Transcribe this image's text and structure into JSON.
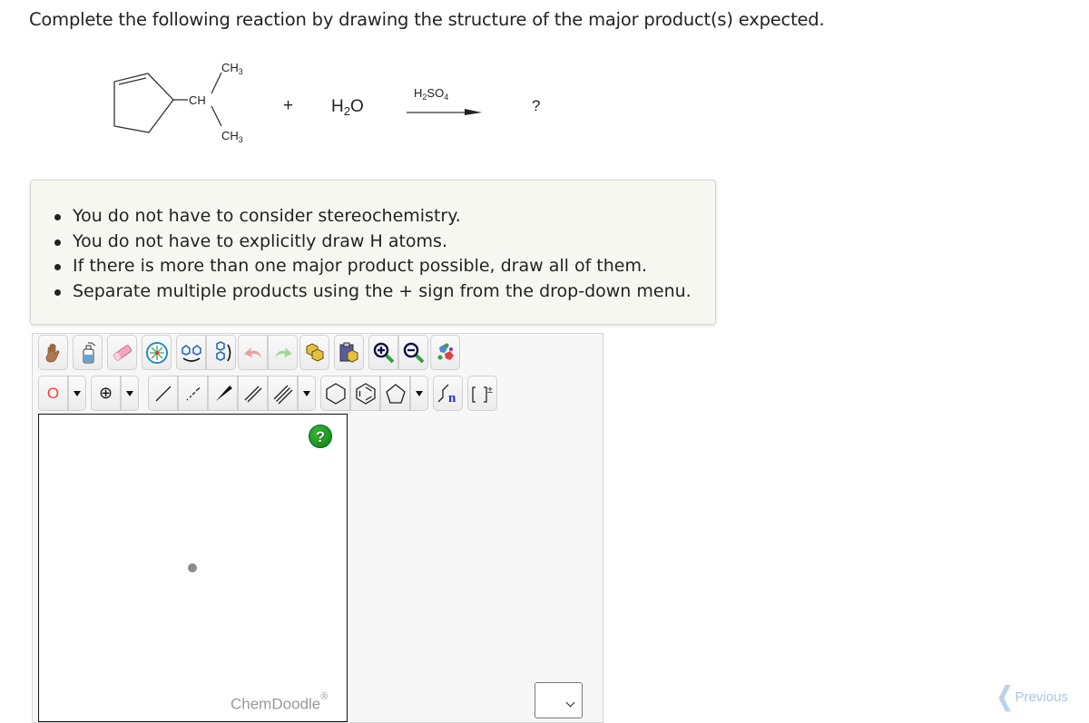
{
  "question": {
    "title": "Complete the following reaction by drawing the structure of the major product(s) expected."
  },
  "reaction": {
    "reactant_labels": {
      "ch": "CH",
      "ch3_top": "CH",
      "ch3_bottom": "CH",
      "three": "3"
    },
    "plus": "+",
    "water": {
      "h": "H",
      "sub": "2",
      "o": "O"
    },
    "reagent": {
      "h": "H",
      "sub2": "2",
      "so": "SO",
      "sub4": "4"
    },
    "product": "?"
  },
  "instructions": [
    "You do not have to consider stereochemistry.",
    "You do not have to explicitly draw H atoms.",
    "If there is more than one major product possible, draw all of them.",
    "Separate multiple products using the + sign from the drop-down menu."
  ],
  "editor": {
    "toolbar_row1": [
      "hand-tool",
      "clear-tool",
      "eraser-tool",
      "center-tool",
      "flip-horizontal-tool",
      "flip-vertical-tool",
      "undo",
      "redo",
      "copy",
      "paste",
      "zoom-in",
      "zoom-out",
      "clean-tool"
    ],
    "toolbar_row2": [
      "atom-oxygen",
      "charge-plus",
      "single-bond",
      "dashed-bond",
      "wedge-bond",
      "double-bond",
      "triple-bond",
      "cyclohexane",
      "benzene",
      "cyclopentane",
      "repeat-unit",
      "bracket-charge"
    ],
    "atom_label": "O",
    "charge_label": "⊕",
    "help_label": "?",
    "brand": "ChemDoodle",
    "brand_mark": "®",
    "select_value": ""
  },
  "navigation": {
    "previous_label": "Previous"
  },
  "colors": {
    "atom_red": "#ff3b30",
    "help_green": "#0a8a0a",
    "link_blue": "#a9c7e0"
  }
}
